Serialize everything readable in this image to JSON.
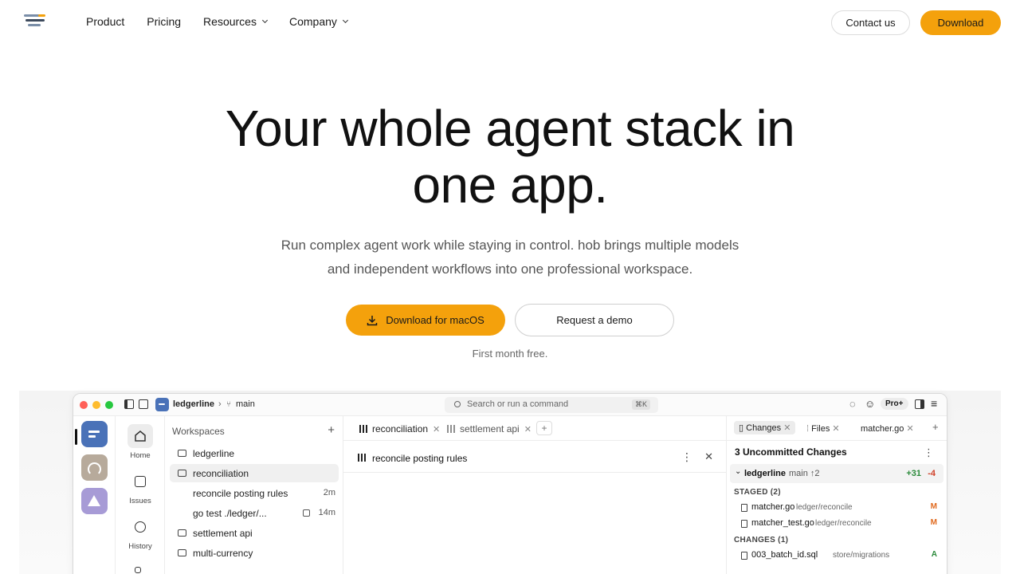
{
  "nav": {
    "links": [
      {
        "label": "Product",
        "dropdown": false
      },
      {
        "label": "Pricing",
        "dropdown": false
      },
      {
        "label": "Resources",
        "dropdown": true
      },
      {
        "label": "Company",
        "dropdown": true
      }
    ],
    "contact_label": "Contact us",
    "download_label": "Download"
  },
  "hero": {
    "title_line1": "Your whole agent stack in",
    "title_line2": "one app.",
    "subtitle_line1": "Run complex agent work while staying in control. hob brings multiple models",
    "subtitle_line2": "and independent workflows into one professional workspace.",
    "primary_cta": "Download for macOS",
    "secondary_cta": "Request a demo",
    "note": "First month free."
  },
  "colors": {
    "accent": "#f4a10c",
    "workspace_blue": "#4a72b8",
    "workspace_tan": "#b7aa9b",
    "workspace_purple": "#a79bd6"
  },
  "app": {
    "project": "ledgerline",
    "branch": "main",
    "search_placeholder": "Search or run a command",
    "search_shortcut": "⌘K",
    "plan_badge": "Pro+",
    "nav": [
      {
        "label": "Home",
        "icon": "home-icon"
      },
      {
        "label": "Issues",
        "icon": "issues-icon"
      },
      {
        "label": "History",
        "icon": "history-icon"
      }
    ],
    "workspaces_heading": "Workspaces",
    "workspaces": [
      {
        "label": "ledgerline",
        "time": "",
        "type": "repo"
      },
      {
        "label": "reconciliation",
        "time": "",
        "type": "folder-open"
      },
      {
        "label": "reconcile posting rules",
        "time": "2m",
        "type": "thread"
      },
      {
        "label": "go test ./ledger/...",
        "time": "14m",
        "type": "thread"
      },
      {
        "label": "settlement api",
        "time": "",
        "type": "folder"
      },
      {
        "label": "multi-currency",
        "time": "",
        "type": "folder"
      }
    ],
    "tabs": [
      {
        "label": "reconciliation"
      },
      {
        "label": "settlement api"
      }
    ],
    "thread_title": "reconcile posting rules",
    "right_tabs": [
      {
        "label": "Changes"
      },
      {
        "label": "Files"
      },
      {
        "label": "matcher.go"
      }
    ],
    "changes_title": "3 Uncommitted Changes",
    "repo": {
      "name": "ledgerline",
      "branch": "main ↑2",
      "added": "+31",
      "removed": "-4"
    },
    "staged_heading": "STAGED (2)",
    "staged": [
      {
        "file": "matcher.go",
        "path": "ledger/reconcile",
        "status": "M"
      },
      {
        "file": "matcher_test.go",
        "path": "ledger/reconcile",
        "status": "M"
      }
    ],
    "changes_heading": "CHANGES (1)",
    "changes": [
      {
        "file": "003_batch_id.sql",
        "path": "store/migrations",
        "status": "A"
      }
    ]
  }
}
